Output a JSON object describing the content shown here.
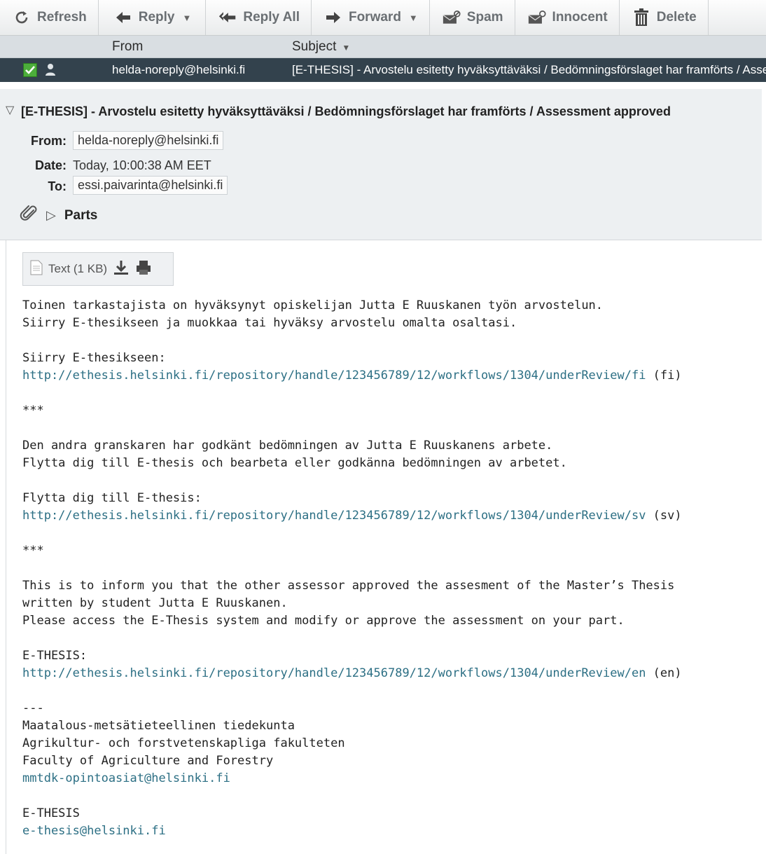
{
  "toolbar": {
    "buttons": [
      {
        "label": "Refresh",
        "icon": "refresh-icon"
      },
      {
        "label": "Reply",
        "icon": "reply-icon",
        "dropdown": true
      },
      {
        "label": "Reply All",
        "icon": "reply-all-icon"
      },
      {
        "label": "Forward",
        "icon": "forward-icon",
        "dropdown": true
      },
      {
        "label": "Spam",
        "icon": "spam-icon"
      },
      {
        "label": "Innocent",
        "icon": "innocent-icon"
      },
      {
        "label": "Delete",
        "icon": "trash-icon"
      }
    ]
  },
  "message_list": {
    "columns": {
      "from": "From",
      "subject": "Subject"
    },
    "selected_row": {
      "from": "helda-noreply@helsinki.fi",
      "subject": "[E-THESIS] - Arvostelu esitetty hyväksyttäväksi / Bedömningsförslaget har framförts / Assessment approved"
    }
  },
  "message": {
    "subject": "[E-THESIS] - Arvostelu esitetty hyväksyttäväksi / Bedömningsförslaget har framförts / Assessment approved",
    "from_label": "From:",
    "from": "helda-noreply@helsinki.fi",
    "date_label": "Date:",
    "date": "Today, 10:00:38 AM EET",
    "to_label": "To:",
    "to": "essi.paivarinta@helsinki.fi",
    "parts_label": "Parts"
  },
  "attachment": {
    "label": "Text (1 KB)"
  },
  "body": {
    "lines": [
      {
        "text": "Toinen tarkastajista on hyväksynyt opiskelijan Jutta E Ruuskanen työn arvostelun."
      },
      {
        "text": "Siirry E-thesikseen ja muokkaa tai hyväksy arvostelu omalta osaltasi."
      },
      {
        "text": ""
      },
      {
        "text": "Siirry E-thesikseen:"
      },
      {
        "link": "http://ethesis.helsinki.fi/repository/handle/123456789/12/workflows/1304/underReview/fi",
        "suffix": " (fi)"
      },
      {
        "text": ""
      },
      {
        "text": "***"
      },
      {
        "text": ""
      },
      {
        "text": "Den andra granskaren har godkänt bedömningen av Jutta E Ruuskanens arbete."
      },
      {
        "text": "Flytta dig till E-thesis och bearbeta eller godkänna bedömningen av arbetet."
      },
      {
        "text": ""
      },
      {
        "text": "Flytta dig till E-thesis:"
      },
      {
        "link": "http://ethesis.helsinki.fi/repository/handle/123456789/12/workflows/1304/underReview/sv",
        "suffix": " (sv)"
      },
      {
        "text": ""
      },
      {
        "text": "***"
      },
      {
        "text": ""
      },
      {
        "text": "This is to inform you that the other assessor approved the assesment of the Master’s Thesis"
      },
      {
        "text": "written by student Jutta E Ruuskanen."
      },
      {
        "text": "Please access the E-Thesis system and modify or approve the assessment on your part."
      },
      {
        "text": ""
      },
      {
        "text": "E-THESIS:"
      },
      {
        "link": "http://ethesis.helsinki.fi/repository/handle/123456789/12/workflows/1304/underReview/en",
        "suffix": " (en)"
      },
      {
        "text": ""
      },
      {
        "text": "---"
      },
      {
        "text": "Maatalous-metsätieteellinen tiedekunta"
      },
      {
        "text": "Agrikultur- och forstvetenskapliga fakulteten"
      },
      {
        "text": "Faculty of Agriculture and Forestry"
      },
      {
        "link": "mmtdk-opintoasiat@helsinki.fi",
        "suffix": ""
      },
      {
        "text": ""
      },
      {
        "text": "E-THESIS"
      },
      {
        "link": "e-thesis@helsinki.fi",
        "suffix": ""
      }
    ]
  }
}
